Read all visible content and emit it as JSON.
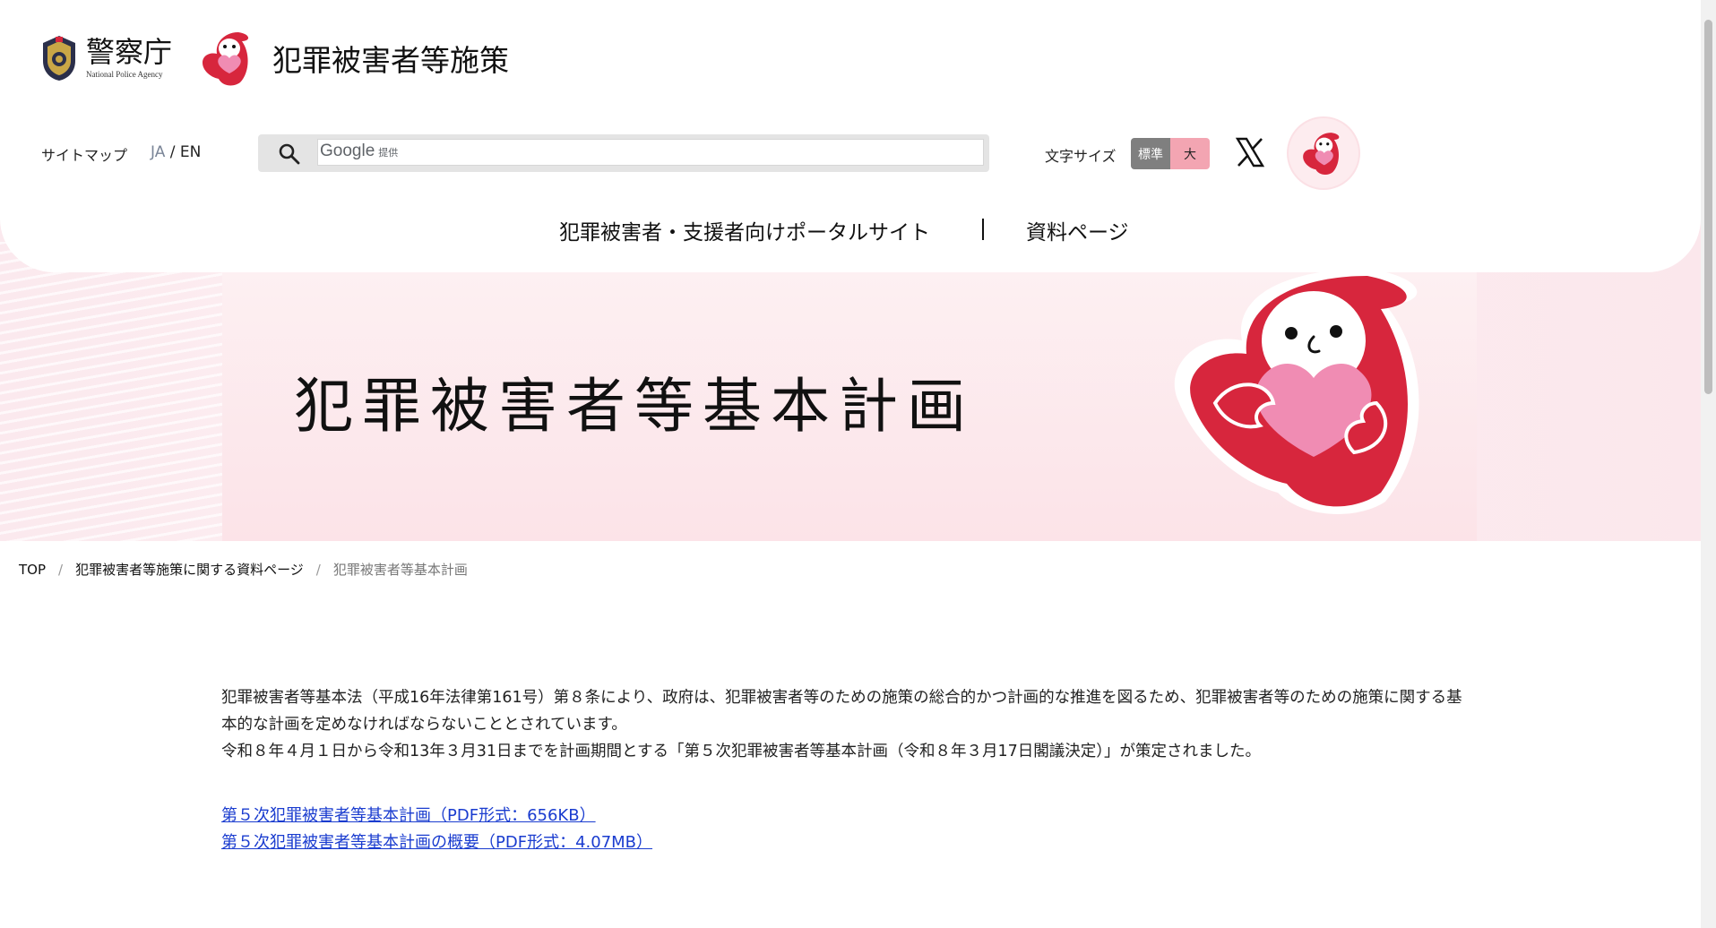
{
  "header": {
    "npa_logo_jp": "警察庁",
    "npa_logo_en": "National Police Agency",
    "policy_title": "犯罪被害者等施策",
    "sitemap": "サイトマップ",
    "lang_ja": "JA",
    "lang_sep": " / ",
    "lang_en": "EN",
    "search_brand": "Google",
    "search_brand_sub": "提供",
    "fontsize_label": "文字サイズ",
    "fontsize_standard": "標準",
    "fontsize_large": "大"
  },
  "nav": {
    "portal": "犯罪被害者・支援者向けポータルサイト",
    "docs": "資料ページ"
  },
  "hero": {
    "title": "犯罪被害者等基本計画"
  },
  "breadcrumb": {
    "top": "TOP",
    "sep": "/",
    "docs_page": "犯罪被害者等施策に関する資料ページ",
    "current": "犯罪被害者等基本計画"
  },
  "content": {
    "para1": "犯罪被害者等基本法（平成16年法律第161号）第８条により、政府は、犯罪被害者等のための施策の総合的かつ計画的な推進を図るため、犯罪被害者等のための施策に関する基本的な計画を定めなければならないこととされています。",
    "para2": "令和８年４月１日から令和13年３月31日までを計画期間とする「第５次犯罪被害者等基本計画（令和８年３月17日閣議決定）」が策定されました。",
    "link1": "第５次犯罪被害者等基本計画（PDF形式：656KB）",
    "link2": "第５次犯罪被害者等基本計画の概要（PDF形式：4.07MB）"
  },
  "colors": {
    "accent_red": "#d7263d",
    "heart_pink": "#f08cb3",
    "link_blue": "#1a3ccf",
    "fontsize_std_bg": "#7f7f7f",
    "fontsize_large_bg": "#f3a5b2"
  }
}
